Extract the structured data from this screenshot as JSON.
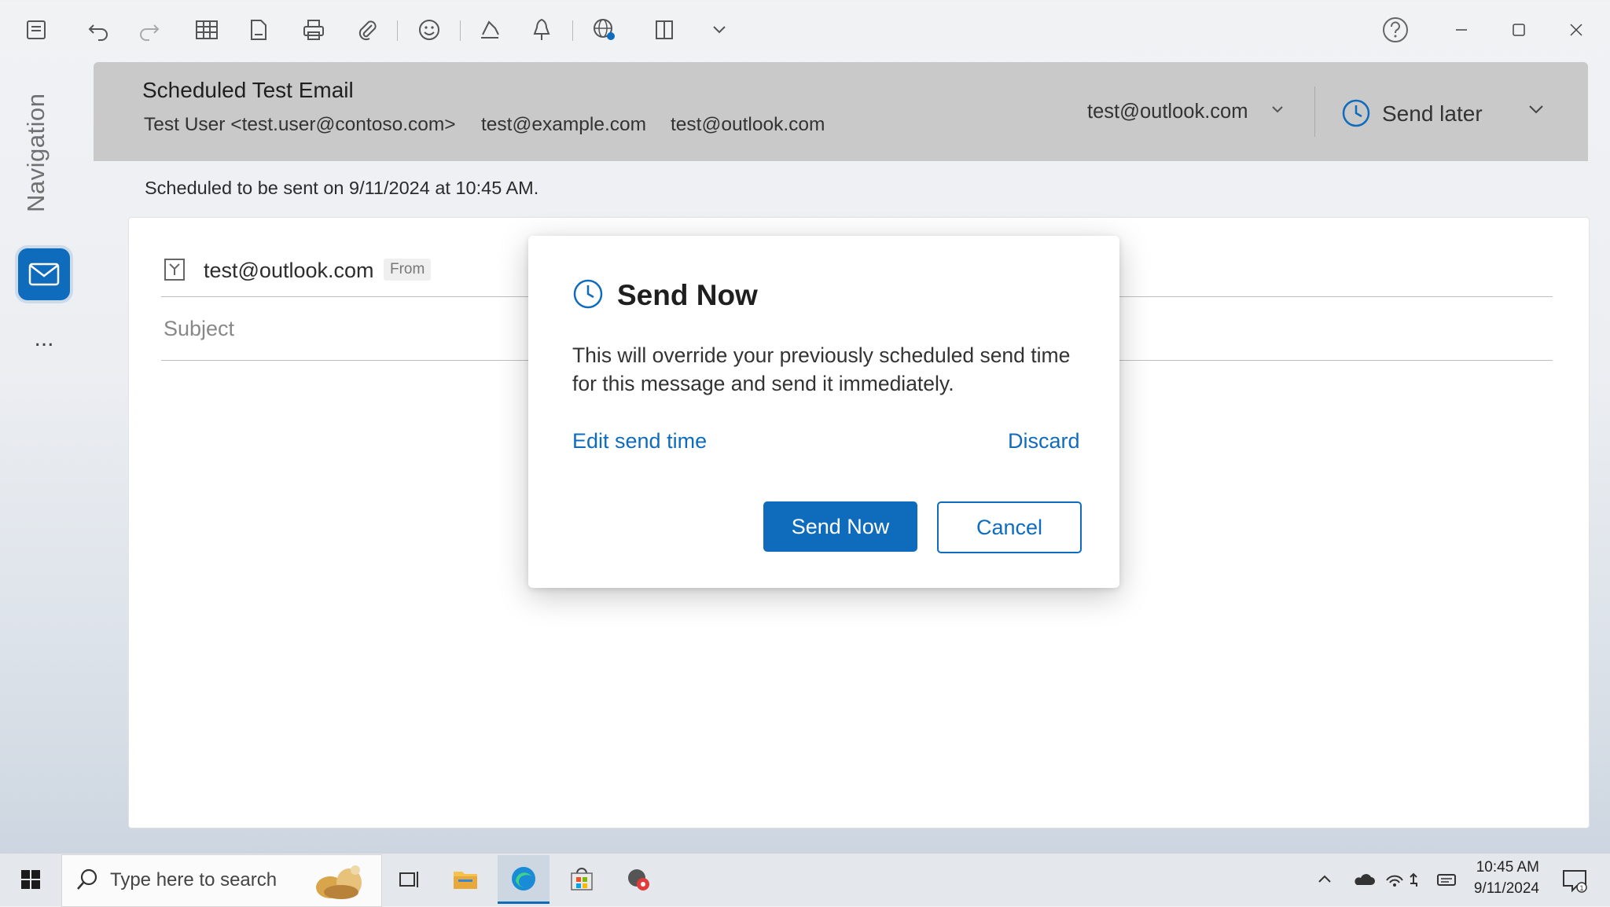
{
  "window": {
    "toolbar_icons": [
      "save-icon",
      "undo-icon",
      "redo-icon",
      "table-icon",
      "document-icon",
      "print-icon",
      "attach-icon",
      "emoji-icon",
      "signature-icon",
      "pin-icon",
      "globe-icon",
      "reader-icon",
      "chevron-down-icon"
    ],
    "controls": [
      "help-icon",
      "minimize-icon",
      "maximize-icon",
      "close-icon"
    ]
  },
  "nav": {
    "label": "Navigation",
    "more": "..."
  },
  "header": {
    "title": "Scheduled Test Email",
    "recipients": [
      "Test User <test.user@contoso.com>",
      "test@example.com",
      "test@outlook.com"
    ],
    "account": "test@outlook.com",
    "send_later": "Send later"
  },
  "scheduled_note": "Scheduled to be sent on 9/11/2024 at 10:45 AM.",
  "compose": {
    "from_email": "test@outlook.com",
    "from_tag": "From",
    "subject_placeholder": "Subject"
  },
  "dialog": {
    "title": "Send Now",
    "body": "This will override your previously scheduled send time for this message and send it immediately.",
    "edit_link": "Edit send time",
    "discard_link": "Discard",
    "primary_button": "Send Now",
    "secondary_button": "Cancel"
  },
  "taskbar": {
    "search_placeholder": "Type here to search",
    "time": "10:45 AM",
    "date": "9/11/2024"
  },
  "colors": {
    "accent": "#0f6cbd",
    "header_bg": "#c9c9c9"
  }
}
